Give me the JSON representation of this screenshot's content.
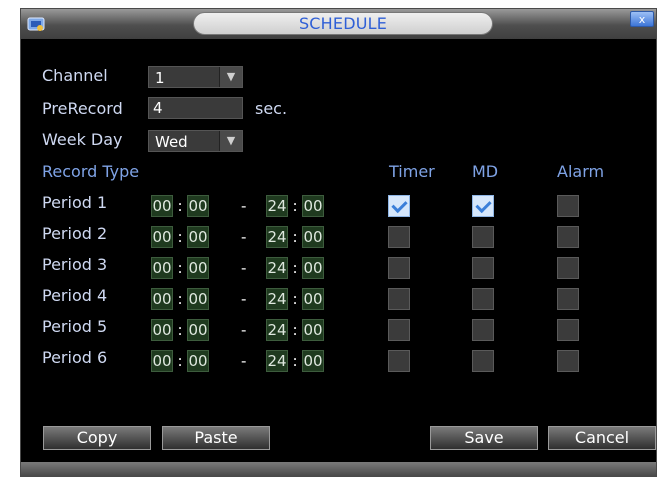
{
  "window": {
    "title": "SCHEDULE",
    "close_symbol": "x"
  },
  "form": {
    "channel_label": "Channel",
    "channel_value": "1",
    "prerecord_label": "PreRecord",
    "prerecord_value": "4",
    "prerecord_unit": "sec.",
    "weekday_label": "Week Day",
    "weekday_value": "Wed",
    "dropdown_arrow": "▼"
  },
  "table": {
    "header_record_type": "Record Type",
    "header_timer": "Timer",
    "header_md": "MD",
    "header_alarm": "Alarm",
    "time_separator": ":",
    "range_separator": "-",
    "rows": [
      {
        "label": "Period 1",
        "start_h": "00",
        "start_m": "00",
        "end_h": "24",
        "end_m": "00",
        "timer": true,
        "md": true,
        "alarm": false
      },
      {
        "label": "Period 2",
        "start_h": "00",
        "start_m": "00",
        "end_h": "24",
        "end_m": "00",
        "timer": false,
        "md": false,
        "alarm": false
      },
      {
        "label": "Period 3",
        "start_h": "00",
        "start_m": "00",
        "end_h": "24",
        "end_m": "00",
        "timer": false,
        "md": false,
        "alarm": false
      },
      {
        "label": "Period 4",
        "start_h": "00",
        "start_m": "00",
        "end_h": "24",
        "end_m": "00",
        "timer": false,
        "md": false,
        "alarm": false
      },
      {
        "label": "Period 5",
        "start_h": "00",
        "start_m": "00",
        "end_h": "24",
        "end_m": "00",
        "timer": false,
        "md": false,
        "alarm": false
      },
      {
        "label": "Period 6",
        "start_h": "00",
        "start_m": "00",
        "end_h": "24",
        "end_m": "00",
        "timer": false,
        "md": false,
        "alarm": false
      }
    ]
  },
  "buttons": {
    "copy": "Copy",
    "paste": "Paste",
    "save": "Save",
    "cancel": "Cancel"
  },
  "colors": {
    "accent_title": "#2f5fd6",
    "label_text": "#cfd9f2",
    "header_text": "#7fa3e6",
    "checked_fill": "#d6e7fb",
    "time_field": "#1f3a1f"
  }
}
